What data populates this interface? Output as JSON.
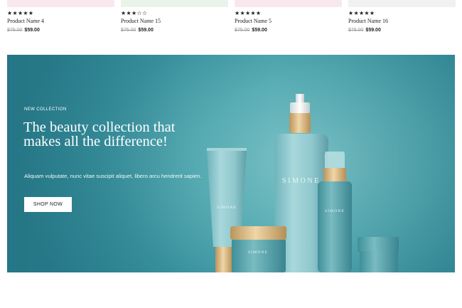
{
  "products": [
    {
      "name": "Product Name 4",
      "stars": "★★★★★",
      "old_price": "$75.00",
      "price": "$59.00",
      "thumb_color": "#f8e8ee"
    },
    {
      "name": "Product Name 15",
      "stars": "★★★☆☆",
      "old_price": "$75.00",
      "price": "$59.00",
      "thumb_color": "#eaf3ea"
    },
    {
      "name": "Product Name 5",
      "stars": "★★★★★",
      "old_price": "$75.00",
      "price": "$59.00",
      "thumb_color": "#f8e8ee"
    },
    {
      "name": "Product Name 16",
      "stars": "★★★★★",
      "old_price": "$75.00",
      "price": "$59.00",
      "thumb_color": "#f1f1f1"
    }
  ],
  "banner": {
    "eyebrow": "NEW COLLECTION",
    "headline": "The beauty collection that makes all the difference!",
    "description": "Aliquam vulputate, nunc vitae suscipit aliquet, libero arcu hendrerit sapien.",
    "button_label": "SHOP NOW",
    "brand_tube": "SIMONE",
    "brand_tall": "SIMONE",
    "brand_jar": "SIMONE",
    "brand_slim": "SIMONE",
    "bg_color": "#4fa6ae",
    "accent_cap": "#d8b886"
  }
}
